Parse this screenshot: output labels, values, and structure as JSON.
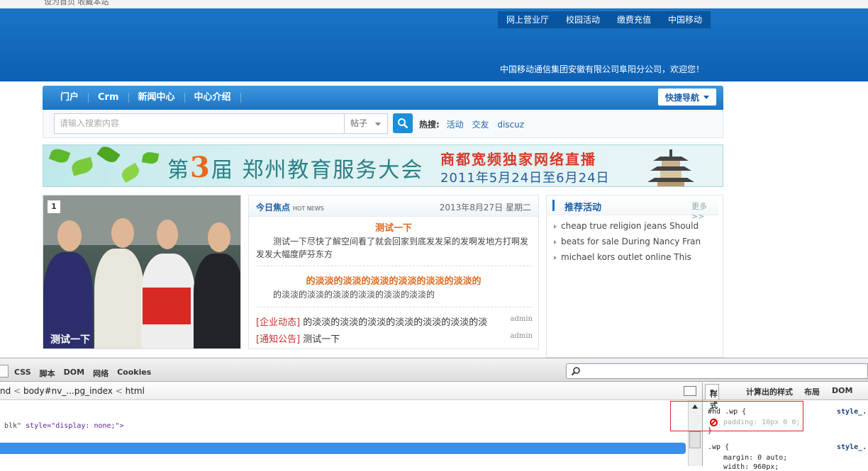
{
  "topbar": {
    "text": "设为首页 收藏本站"
  },
  "header": {
    "top_links": [
      "网上营业厅",
      "校园活动",
      "缴费充值",
      "中国移动"
    ],
    "welcome": "中国移动通信集团安徽有限公司阜阳分公司，欢迎您！"
  },
  "nav": {
    "items": [
      "门户",
      "Crm",
      "新闻中心",
      "中心介绍"
    ],
    "quick_label": "快捷导航"
  },
  "search": {
    "placeholder": "请输入搜索内容",
    "type": "帖子",
    "hot_label": "热搜:",
    "hot_items": [
      "活动",
      "交友",
      "discuz"
    ]
  },
  "banner": {
    "prefix": "第",
    "num": "3",
    "suffix": "届 郑州教育服务大会",
    "line1": "商都宽频独家网络直播",
    "line2": "2011年5月24日至6月24日"
  },
  "slide": {
    "index": "1",
    "caption": "测试一下"
  },
  "news": {
    "title": "今日焦点",
    "title_en": "HOT NEWS",
    "date": "2013年8月27日 星期二",
    "headline1": "测试一下",
    "summary1": "测试一下尽快了解空间看了就会回家到底发发呆的发啊发地方打啊发发发大幅度萨芬东方",
    "headline2": "的淡淡的淡淡的淡淡的淡淡的淡淡的淡淡的",
    "summary2": "的淡淡的淡淡的淡淡的淡淡的淡淡的淡淡的",
    "rows": [
      {
        "cat": "[企业动态]",
        "text": "的淡淡的淡淡的淡淡的淡淡的淡淡的淡淡的淡",
        "author": "admin"
      },
      {
        "cat": "[通知公告]",
        "text": "测试一下",
        "author": "admin"
      }
    ]
  },
  "activities": {
    "title": "推荐活动",
    "more": "更多>>",
    "items": [
      "cheap true religion jeans Should",
      "beats for sale During Nancy Fran",
      "michael kors outlet online This"
    ]
  },
  "devtools": {
    "tabs": [
      "CSS",
      "脚本",
      "DOM",
      "网络",
      "Cookies"
    ],
    "breadcrumb": [
      "nd",
      "body#nv_...pg_index",
      "html"
    ],
    "code_line_attr": "blk\"",
    "code_line_style": " style=\"display: none;\">",
    "side_tabs": [
      "样式",
      "计算出的样式",
      "布局",
      "DOM"
    ],
    "rule1_selector": "#hd .wp {",
    "rule1_decl": "padding: 10px 0 0;",
    "rule1_close": "}",
    "rule1_source": "style_...",
    "rule2_selector": ".wp {",
    "rule2_decl1": "margin: 0 auto;",
    "rule2_decl2": "width: 960px;",
    "rule2_source": "style_..."
  }
}
